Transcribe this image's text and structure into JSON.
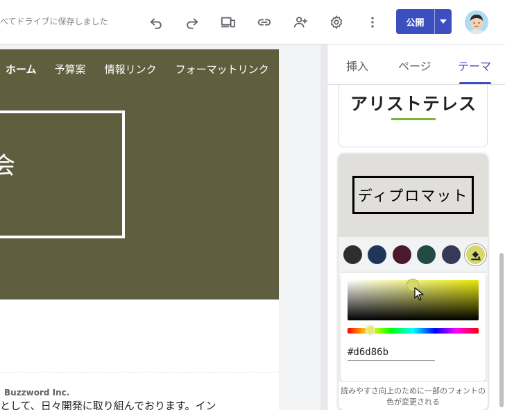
{
  "toolbar": {
    "save_status": "べてドライブに保存しました",
    "icons": [
      "undo-icon",
      "redo-icon",
      "preview-devices-icon",
      "link-icon",
      "share-person-add-icon",
      "settings-gear-icon",
      "more-vert-icon"
    ],
    "publish_label": "公開",
    "accent_color": "#3c4fbf"
  },
  "site": {
    "nav": {
      "items": [
        "ホーム",
        "予算案",
        "情報リンク",
        "フォーマットリンク"
      ],
      "active_index": 0
    },
    "hero_color": "#5f5f3f",
    "hero_glyph": "会",
    "footer": {
      "company": "Buzzword Inc.",
      "text": "として、日々開発に取り組んでおります。イン"
    }
  },
  "panel": {
    "tabs": [
      {
        "label": "挿入"
      },
      {
        "label": "ページ"
      },
      {
        "label": "テーマ"
      }
    ],
    "active_tab": "テーマ",
    "themes": {
      "aristotle": {
        "title": "アリストテレス",
        "accent": "#7cb342"
      },
      "diplomat": {
        "title": "ディプロマット",
        "swatches": [
          "#2e2e2e",
          "#1e3757",
          "#4a1a2c",
          "#224b44",
          "#373a57",
          "#d6d86b"
        ],
        "selected_swatch_index": 5
      }
    },
    "color_picker": {
      "hex_value": "#d6d86b",
      "note": "読みやすさ向上のために一部のフォントの色が変更される"
    }
  }
}
